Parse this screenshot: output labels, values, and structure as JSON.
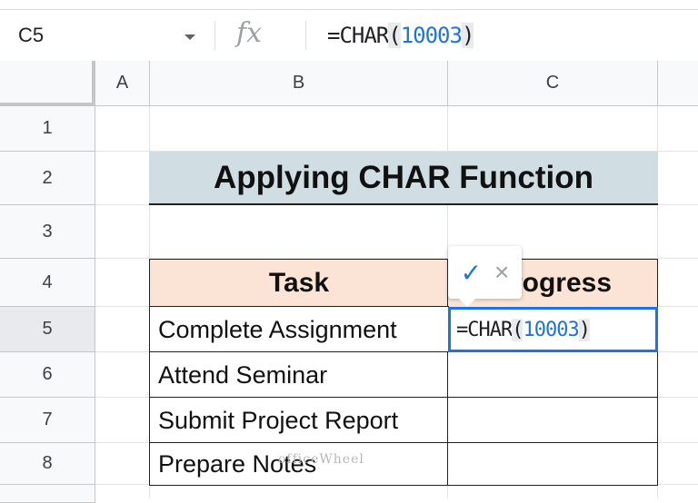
{
  "formula_bar": {
    "name_box": "C5",
    "fx_label": "fx",
    "formula_prefix": "=CHAR",
    "formula_open": "(",
    "formula_number": "10003",
    "formula_close": ")"
  },
  "columns": [
    "A",
    "B",
    "C"
  ],
  "rows": [
    "1",
    "2",
    "3",
    "4",
    "5",
    "6",
    "7",
    "8"
  ],
  "title": "Applying CHAR Function",
  "table": {
    "header_task": "Task",
    "header_progress": "Progress",
    "tasks": [
      "Complete Assignment",
      "Attend Seminar",
      "Submit Project Report",
      "Prepare Notes"
    ]
  },
  "editor": {
    "prefix": "=CHAR",
    "open": "(",
    "number": "10003",
    "close": ")"
  },
  "suggestion": {
    "accept": "✓",
    "reject": "×"
  },
  "watermark": "officeWheel"
}
